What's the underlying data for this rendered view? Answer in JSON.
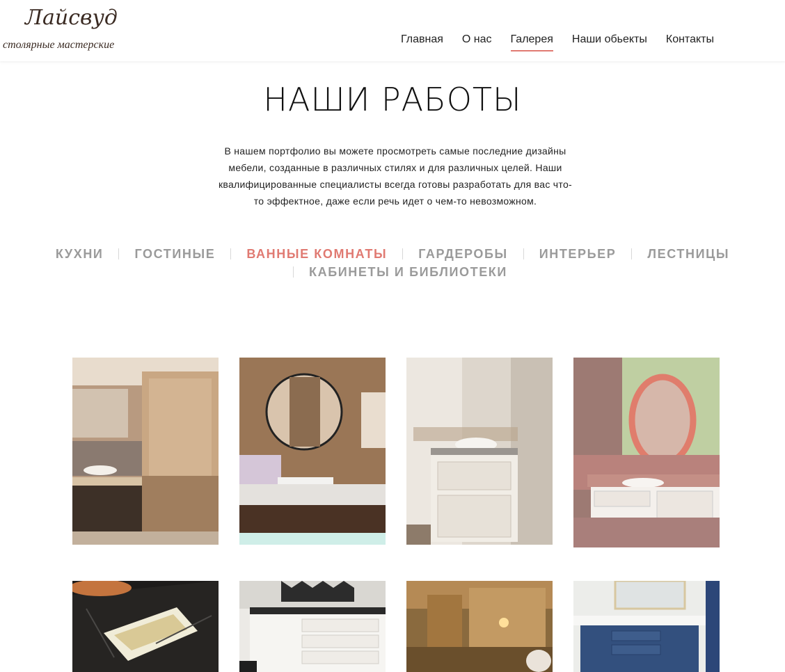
{
  "logo": {
    "script": "Лайсвуд",
    "subtitle": "столярные мастерские"
  },
  "nav": {
    "items": [
      {
        "label": "Главная",
        "active": false
      },
      {
        "label": "О нас",
        "active": false
      },
      {
        "label": "Галерея",
        "active": true
      },
      {
        "label": "Наши обьекты",
        "active": false
      },
      {
        "label": "Контакты",
        "active": false
      }
    ]
  },
  "page": {
    "title": "НАШИ РАБОТЫ",
    "intro": "В нашем портфолио вы можете просмотреть самые последние дизайны мебели, созданные в различных стилях и для различных целей. Наши квалифицированные специалисты всегда готовы разработать для вас что-то эффектное, даже если речь идет о чем-то невозможном."
  },
  "filters": [
    {
      "label": "КУХНИ",
      "active": false
    },
    {
      "label": "ГОСТИНЫЕ",
      "active": false
    },
    {
      "label": "ВАННЫЕ КОМНАТЫ",
      "active": true
    },
    {
      "label": "ГАРДЕРОБЫ",
      "active": false
    },
    {
      "label": "ИНТЕРЬЕР",
      "active": false
    },
    {
      "label": "ЛЕСТНИЦЫ",
      "active": false
    },
    {
      "label": "КАБИНЕТЫ И БИБЛИОТЕКИ",
      "active": false
    }
  ],
  "colors": {
    "accent": "#e07a72",
    "filter_inactive": "#9a9a9a",
    "text": "#1f1f1f"
  },
  "gallery": {
    "images": [
      {
        "name": "bathroom-photo-1",
        "subject": "bathroom with beige marble and dark vanity"
      },
      {
        "name": "bathroom-photo-2",
        "subject": "wood panel bathroom with round mirror"
      },
      {
        "name": "bathroom-photo-3",
        "subject": "white vanity with vessel sink"
      },
      {
        "name": "bathroom-photo-4",
        "subject": "pink marble bathroom with coral round mirror"
      },
      {
        "name": "bathroom-photo-5",
        "subject": "black marble countertop with open drawer"
      },
      {
        "name": "bathroom-photo-6",
        "subject": "white vanity with geometric tile wall"
      },
      {
        "name": "bathroom-photo-7",
        "subject": "warm lit beige bathroom"
      },
      {
        "name": "bathroom-photo-8",
        "subject": "blue vanity with white countertop"
      }
    ]
  }
}
